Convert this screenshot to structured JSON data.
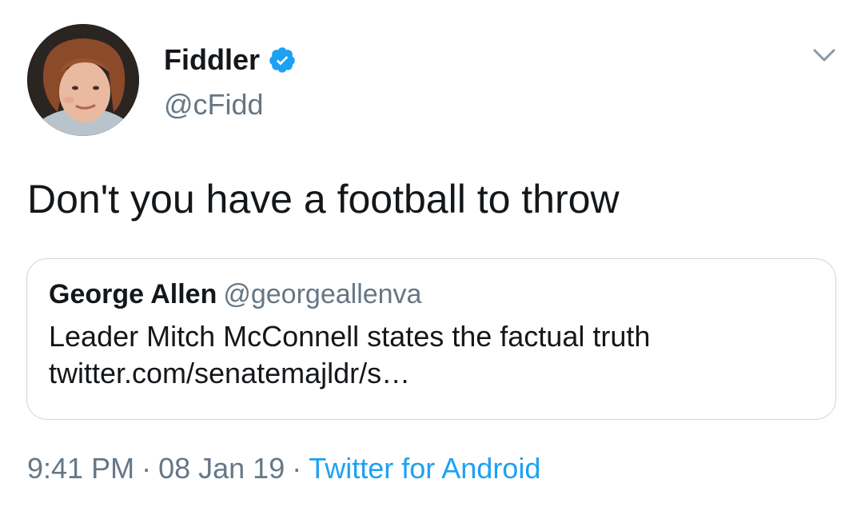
{
  "author": {
    "display_name": "Fiddler",
    "handle": "@cFidd",
    "verified_icon": "verified-badge-icon",
    "avatar_icon": "avatar"
  },
  "tweet": {
    "text": "Don't you have a football to throw"
  },
  "quoted_tweet": {
    "display_name": "George Allen",
    "handle": "@georgeallenva",
    "line1": "Leader Mitch McConnell states the factual truth",
    "line2": "twitter.com/senatemajldr/s…"
  },
  "meta": {
    "time": "9:41 PM",
    "date": "08 Jan 19",
    "separator": "·",
    "source": "Twitter for Android"
  },
  "colors": {
    "text": "#14171a",
    "secondary": "#657786",
    "accent": "#1da1f2",
    "border": "#ccd6dd"
  },
  "menu_icon": "chevron-down-icon"
}
